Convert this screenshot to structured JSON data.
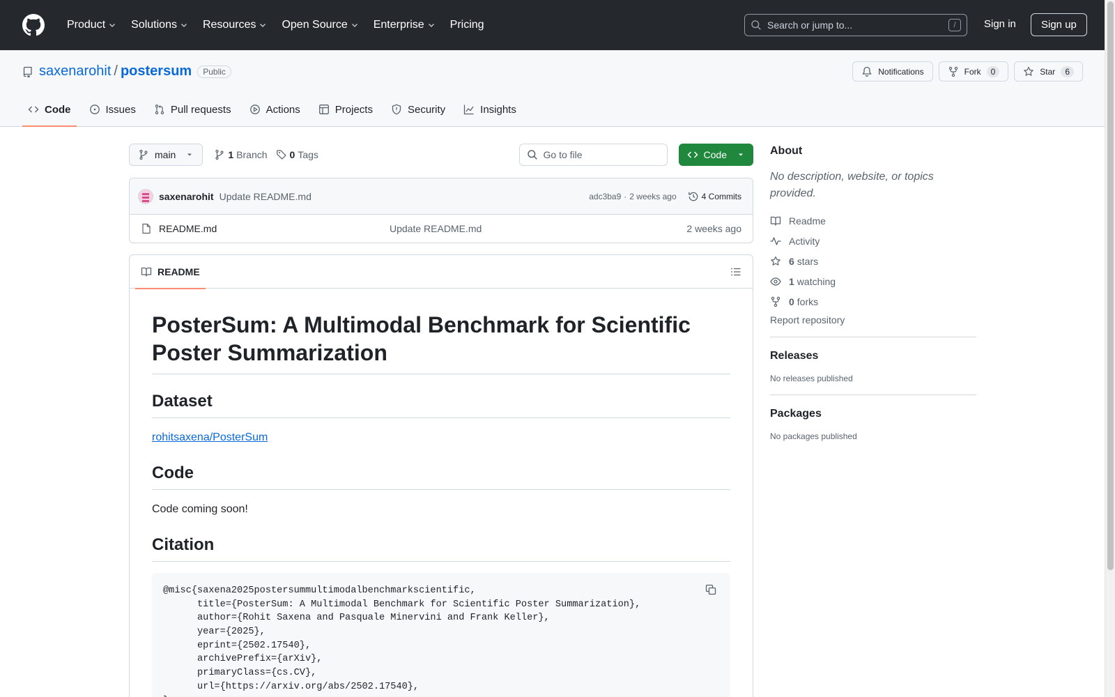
{
  "nav": {
    "items": [
      "Product",
      "Solutions",
      "Resources",
      "Open Source",
      "Enterprise",
      "Pricing"
    ],
    "search_placeholder": "Search or jump to...",
    "search_shortcut": "/",
    "sign_in": "Sign in",
    "sign_up": "Sign up"
  },
  "repo": {
    "owner": "saxenarohit",
    "separator": "/",
    "name": "postersum",
    "visibility": "Public",
    "notifications_label": "Notifications",
    "fork_label": "Fork",
    "fork_count": "0",
    "star_label": "Star",
    "star_count": "6"
  },
  "tabs": [
    {
      "label": "Code",
      "icon": "code-icon",
      "active": true
    },
    {
      "label": "Issues",
      "icon": "issue-icon"
    },
    {
      "label": "Pull requests",
      "icon": "pull-request-icon"
    },
    {
      "label": "Actions",
      "icon": "play-icon"
    },
    {
      "label": "Projects",
      "icon": "table-icon"
    },
    {
      "label": "Security",
      "icon": "shield-icon"
    },
    {
      "label": "Insights",
      "icon": "graph-icon"
    }
  ],
  "toolbar": {
    "branch": "main",
    "branch_count": "1",
    "branch_label": "Branch",
    "tag_count": "0",
    "tag_label": "Tags",
    "go_to_file": "Go to file",
    "code_button": "Code"
  },
  "latest_commit": {
    "author": "saxenarohit",
    "message": "Update README.md",
    "hash": "adc3ba9",
    "dot": "·",
    "time": "2 weeks ago",
    "commits_count": "4 Commits"
  },
  "files": [
    {
      "name": "README.md",
      "message": "Update README.md",
      "date": "2 weeks ago"
    }
  ],
  "readme": {
    "tab_label": "README",
    "title_line1": "PosterSum: A Multimodal Benchmark for Scientific",
    "title_line2": "Poster Summarization",
    "dataset_heading": "Dataset",
    "dataset_link": "rohitsaxena/PosterSum",
    "code_heading": "Code",
    "code_text": "Code coming soon!",
    "citation_heading": "Citation",
    "citation_lines": [
      "@misc{saxena2025postersummultimodalbenchmarkscientific,",
      "      title={PosterSum: A Multimodal Benchmark for Scientific Poster Summarization},",
      "      author={Rohit Saxena and Pasquale Minervini and Frank Keller},",
      "      year={2025},",
      "      eprint={2502.17540},",
      "      archivePrefix={arXiv},",
      "      primaryClass={cs.CV},",
      "      url={https://arxiv.org/abs/2502.17540},",
      "}"
    ]
  },
  "about": {
    "heading": "About",
    "description": "No description, website, or topics provided.",
    "readme": "Readme",
    "activity": "Activity",
    "stars_count": "6",
    "stars_label": "stars",
    "watching_count": "1",
    "watching_label": "watching",
    "forks_count": "0",
    "forks_label": "forks",
    "report": "Report repository"
  },
  "releases": {
    "heading": "Releases",
    "text": "No releases published"
  },
  "packages": {
    "heading": "Packages",
    "text": "No packages published"
  },
  "colors": {
    "header_bg": "#25292e",
    "accent_blue": "#0969da",
    "code_button_green": "#1f883d",
    "tab_underline": "#fd8c73"
  }
}
